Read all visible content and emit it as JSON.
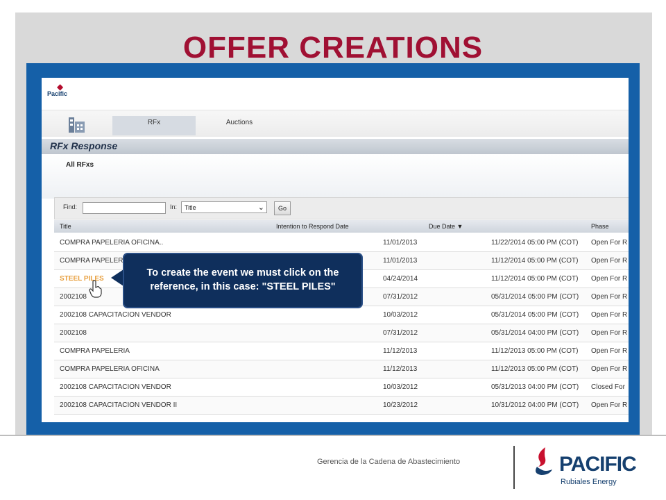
{
  "slide": {
    "title": "OFFER CREATIONS",
    "footer_text": "Gerencia de la Cadena de Abastecimiento",
    "brand": {
      "name": "PACIFIC",
      "tagline": "Rubiales Energy"
    }
  },
  "app": {
    "logo_text": "Pacific",
    "tabs": [
      {
        "label": "RFx"
      },
      {
        "label": "Auctions"
      }
    ],
    "section_title": "RFx Response",
    "subtitle": "All RFxs",
    "filter": {
      "find_label": "Find:",
      "find_value": "",
      "in_label": "In:",
      "in_selected": "Title",
      "go_label": "Go"
    },
    "table": {
      "headers": [
        "Title",
        "Intention to Respond Date",
        "Due Date ▼",
        "Phase"
      ],
      "rows": [
        {
          "title": "COMPRA PAPELERIA OFICINA..",
          "intention": "11/01/2013",
          "due": "11/22/2014 05:00 PM (COT)",
          "phase": "Open For R"
        },
        {
          "title": "COMPRA PAPELERIA",
          "intention": "11/01/2013",
          "due": "11/12/2014 05:00 PM (COT)",
          "phase": "Open For R"
        },
        {
          "title": "STEEL PILES",
          "intention": "04/24/2014",
          "due": "11/12/2014 05:00 PM (COT)",
          "phase": "Open For R"
        },
        {
          "title": "2002108",
          "intention": "07/31/2012",
          "due": "05/31/2014 05:00 PM (COT)",
          "phase": "Open For R"
        },
        {
          "title": "2002108 CAPACITACION VENDOR",
          "intention": "10/03/2012",
          "due": "05/31/2014 05:00 PM (COT)",
          "phase": "Open For R"
        },
        {
          "title": "2002108",
          "intention": "07/31/2012",
          "due": "05/31/2014 04:00 PM (COT)",
          "phase": "Open For R"
        },
        {
          "title": "COMPRA PAPELERIA",
          "intention": "11/12/2013",
          "due": "11/12/2013 05:00 PM (COT)",
          "phase": "Open For R"
        },
        {
          "title": "COMPRA PAPELERIA OFICINA",
          "intention": "11/12/2013",
          "due": "11/12/2013 05:00 PM (COT)",
          "phase": "Open For R"
        },
        {
          "title": "2002108 CAPACITACION VENDOR",
          "intention": "10/03/2012",
          "due": "05/31/2013 04:00 PM (COT)",
          "phase": "Closed For"
        },
        {
          "title": "2002108 CAPACITACION VENDOR II",
          "intention": "10/23/2012",
          "due": "10/31/2012 04:00 PM (COT)",
          "phase": "Open For R"
        }
      ]
    }
  },
  "callout": {
    "line1": "To create the event we must click on the",
    "line2": "reference, in this case: \"STEEL PILES\""
  },
  "colors": {
    "title_red": "#a01033",
    "frame_blue": "#1560a8",
    "callout_navy": "#0f2f5c",
    "link_orange": "#e8a040"
  }
}
